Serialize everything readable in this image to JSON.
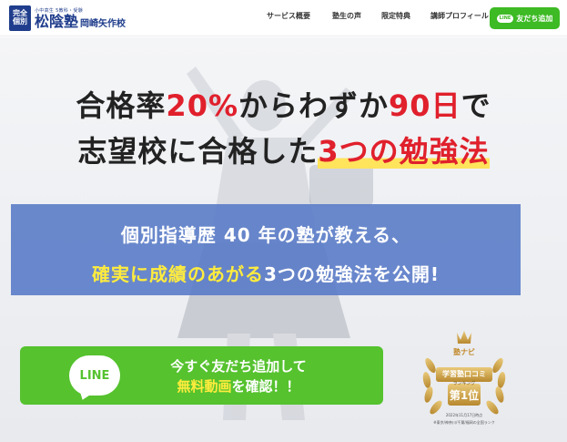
{
  "header": {
    "logo": {
      "badge_top": "完全",
      "badge_bottom": "個別",
      "tagline": "小中高生 5教科・受験",
      "name": "松陰塾",
      "branch": "岡崎矢作校"
    },
    "nav": [
      "サービス概要",
      "塾生の声",
      "限定特典",
      "講師プロフィール"
    ],
    "line_button": {
      "badge": "LINE",
      "label": "友だち追加"
    }
  },
  "hero": {
    "headline1": {
      "a": "合格率",
      "b": "20%",
      "c": "からわずか",
      "d": "90日",
      "e": "で"
    },
    "headline2": {
      "a": "志望校に合格した",
      "b": "3つの勉強法"
    },
    "box_line1": "個別指導歴 40 年の塾が教える、",
    "box_line2": {
      "a": "確実に成績のあがる",
      "b": "3つの勉強法を公開!"
    },
    "cta": {
      "logo": "LINE",
      "line1": "今すぐ友だち追加して",
      "line2a": "無料動画",
      "line2b": "を確認！！"
    },
    "award": {
      "brand": "塾ナビ",
      "title": "学習塾口コミ",
      "sub": "ランキング",
      "rank": "第1位",
      "date": "2022年11月17日時点",
      "note": "※東京/神奈川/千葉/福岡の全国ランク"
    }
  },
  "colors": {
    "brand_blue": "#1f3d8c",
    "accent_red": "#e0202c",
    "line_green": "#3dba24",
    "box_blue": "#5679c6",
    "highlight_yellow": "#ffec3d"
  }
}
